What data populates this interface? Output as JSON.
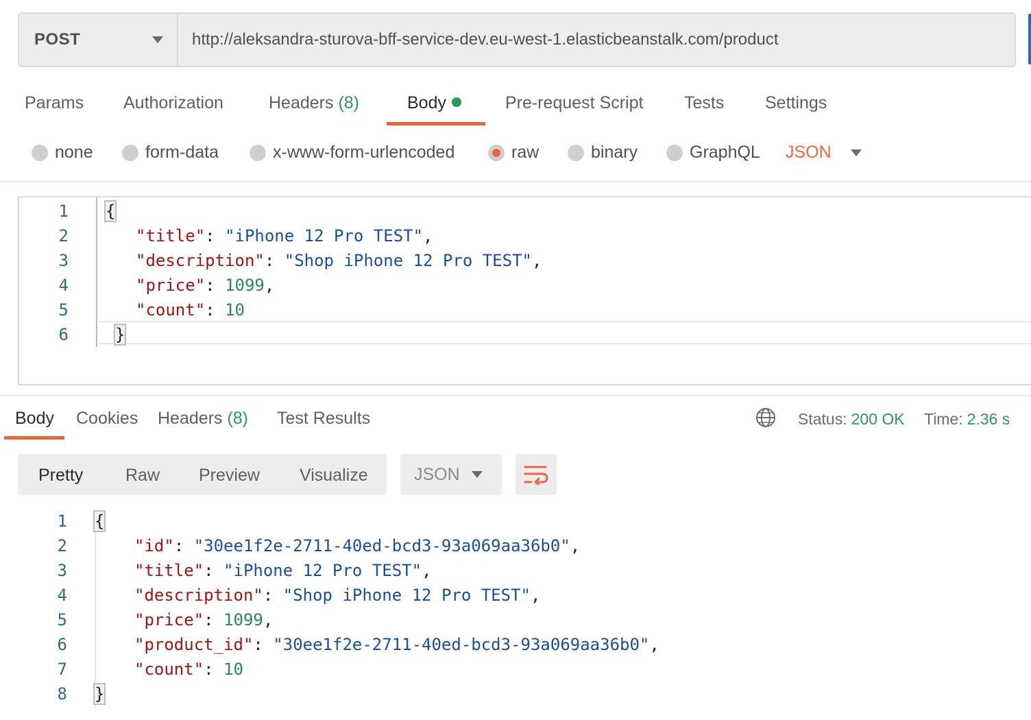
{
  "request": {
    "method": "POST",
    "url": "http://aleksandra-sturova-bff-service-dev.eu-west-1.elasticbeanstalk.com/product",
    "tabs": {
      "params": "Params",
      "authorization": "Authorization",
      "headers": "Headers",
      "headers_count": "(8)",
      "body": "Body",
      "prerequest": "Pre-request Script",
      "tests": "Tests",
      "settings": "Settings"
    },
    "body_types": {
      "none": "none",
      "form_data": "form-data",
      "urlencoded": "x-www-form-urlencoded",
      "raw": "raw",
      "binary": "binary",
      "graphql": "GraphQL",
      "selected": "raw"
    },
    "language": "JSON",
    "code_lines": [
      {
        "num": "1",
        "text": "{"
      },
      {
        "num": "2",
        "key": "\"title\"",
        "value": "\"iPhone 12 Pro TEST\"",
        "tail": ","
      },
      {
        "num": "3",
        "key": "\"description\"",
        "value": "\"Shop iPhone 12 Pro TEST\"",
        "tail": ","
      },
      {
        "num": "4",
        "key": "\"price\"",
        "value": "1099",
        "tail": ","
      },
      {
        "num": "5",
        "key": "\"count\"",
        "value": "10",
        "tail": ""
      },
      {
        "num": "6",
        "text": "}"
      }
    ]
  },
  "response": {
    "tabs": {
      "body": "Body",
      "cookies": "Cookies",
      "headers": "Headers",
      "headers_count": "(8)",
      "test_results": "Test Results"
    },
    "status_label": "Status:",
    "status_value": "200 OK",
    "time_label": "Time:",
    "time_value": "2.36 s",
    "views": {
      "pretty": "Pretty",
      "raw": "Raw",
      "preview": "Preview",
      "visualize": "Visualize"
    },
    "format": "JSON",
    "code_lines": [
      {
        "num": "1",
        "text": "{"
      },
      {
        "num": "2",
        "key": "\"id\"",
        "value": "\"30ee1f2e-2711-40ed-bcd3-93a069aa36b0\"",
        "tail": ","
      },
      {
        "num": "3",
        "key": "\"title\"",
        "value": "\"iPhone 12 Pro TEST\"",
        "tail": ","
      },
      {
        "num": "4",
        "key": "\"description\"",
        "value": "\"Shop iPhone 12 Pro TEST\"",
        "tail": ","
      },
      {
        "num": "5",
        "key": "\"price\"",
        "value": "1099",
        "tail": ","
      },
      {
        "num": "6",
        "key": "\"product_id\"",
        "value": "\"30ee1f2e-2711-40ed-bcd3-93a069aa36b0\"",
        "tail": ","
      },
      {
        "num": "7",
        "key": "\"count\"",
        "value": "10",
        "tail": ""
      },
      {
        "num": "8",
        "text": "}"
      }
    ]
  },
  "colors": {
    "accent": "#e9683b",
    "success": "#2a9a57",
    "json_key": "#a31515",
    "json_string": "#1a4f9c",
    "json_number": "#2a8a52",
    "line_number": "#2c6b8a"
  },
  "icons": {
    "method_caret": "chevron-down-icon",
    "globe": "globe-icon",
    "wrap": "wrap-lines-icon"
  }
}
